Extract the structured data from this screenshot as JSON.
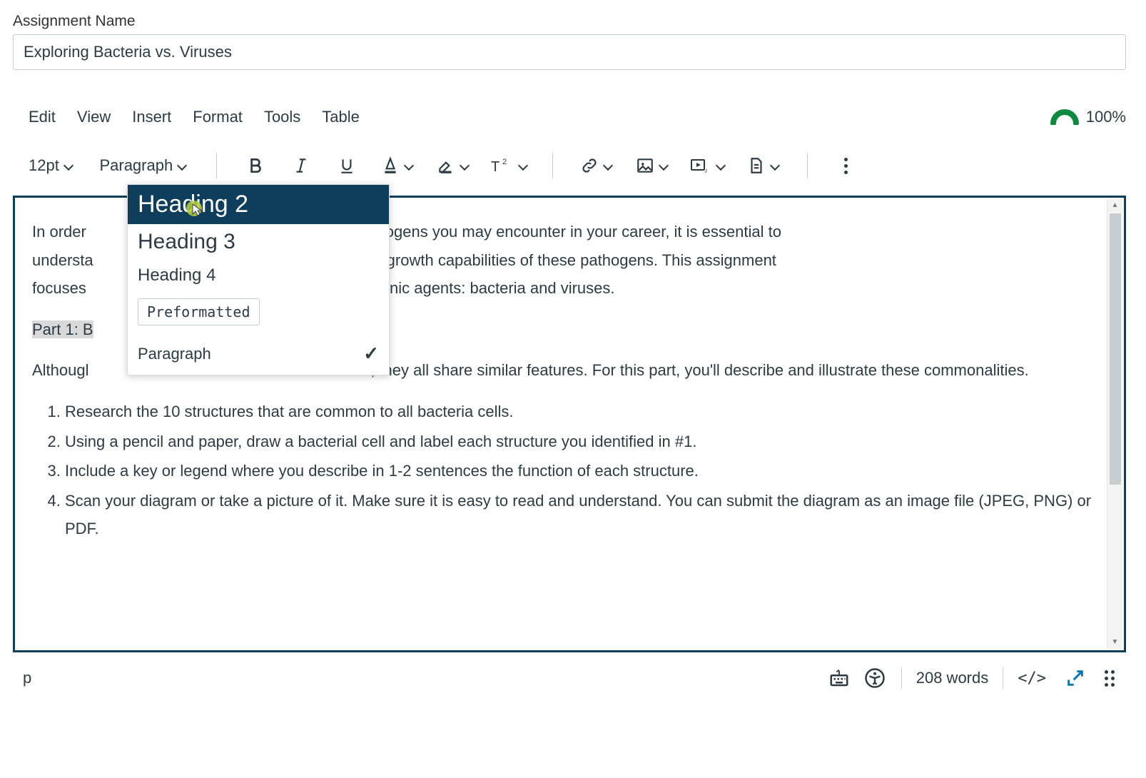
{
  "field_label": "Assignment Name",
  "assignment_name_value": "Exploring Bacteria vs. Viruses",
  "menubar": {
    "items": [
      "Edit",
      "View",
      "Insert",
      "Format",
      "Tools",
      "Table"
    ],
    "a11y_score": "100%"
  },
  "toolbar": {
    "font_size": "12pt",
    "block_type": "Paragraph"
  },
  "block_dropdown": {
    "heading2": "Heading 2",
    "heading3": "Heading 3",
    "heading4": "Heading 4",
    "preformatted": "Preformatted",
    "paragraph": "Paragraph",
    "selected": "paragraph"
  },
  "content": {
    "intro_part1": "In order",
    "intro_mid": " pathogens you may encounter in your career, it is essential to",
    "intro_line2a": "understa",
    "intro_line2b": ", and growth capabilities of these pathogens. This assignment",
    "intro_line3a": "focuses ",
    "intro_line3b": "thogenic agents: bacteria and viruses.",
    "part1_heading": "Part 1: B",
    "although_a": "Althougl",
    "although_b": "eria, they all share similar features. For this part, you'll describe and illustrate these commonalities.",
    "ol": [
      "Research the 10 structures that are common to all bacteria cells.",
      "Using a pencil and paper, draw a bacterial cell and label each structure you identified in #1.",
      "Include a key or legend where you describe in 1-2 sentences the function of each structure.",
      "Scan your diagram or take a picture of it. Make sure it is easy to read and understand. You can submit the diagram as an image file (JPEG, PNG) or PDF."
    ]
  },
  "statusbar": {
    "path": "p",
    "word_count": "208 words",
    "html_toggle": "</>"
  }
}
